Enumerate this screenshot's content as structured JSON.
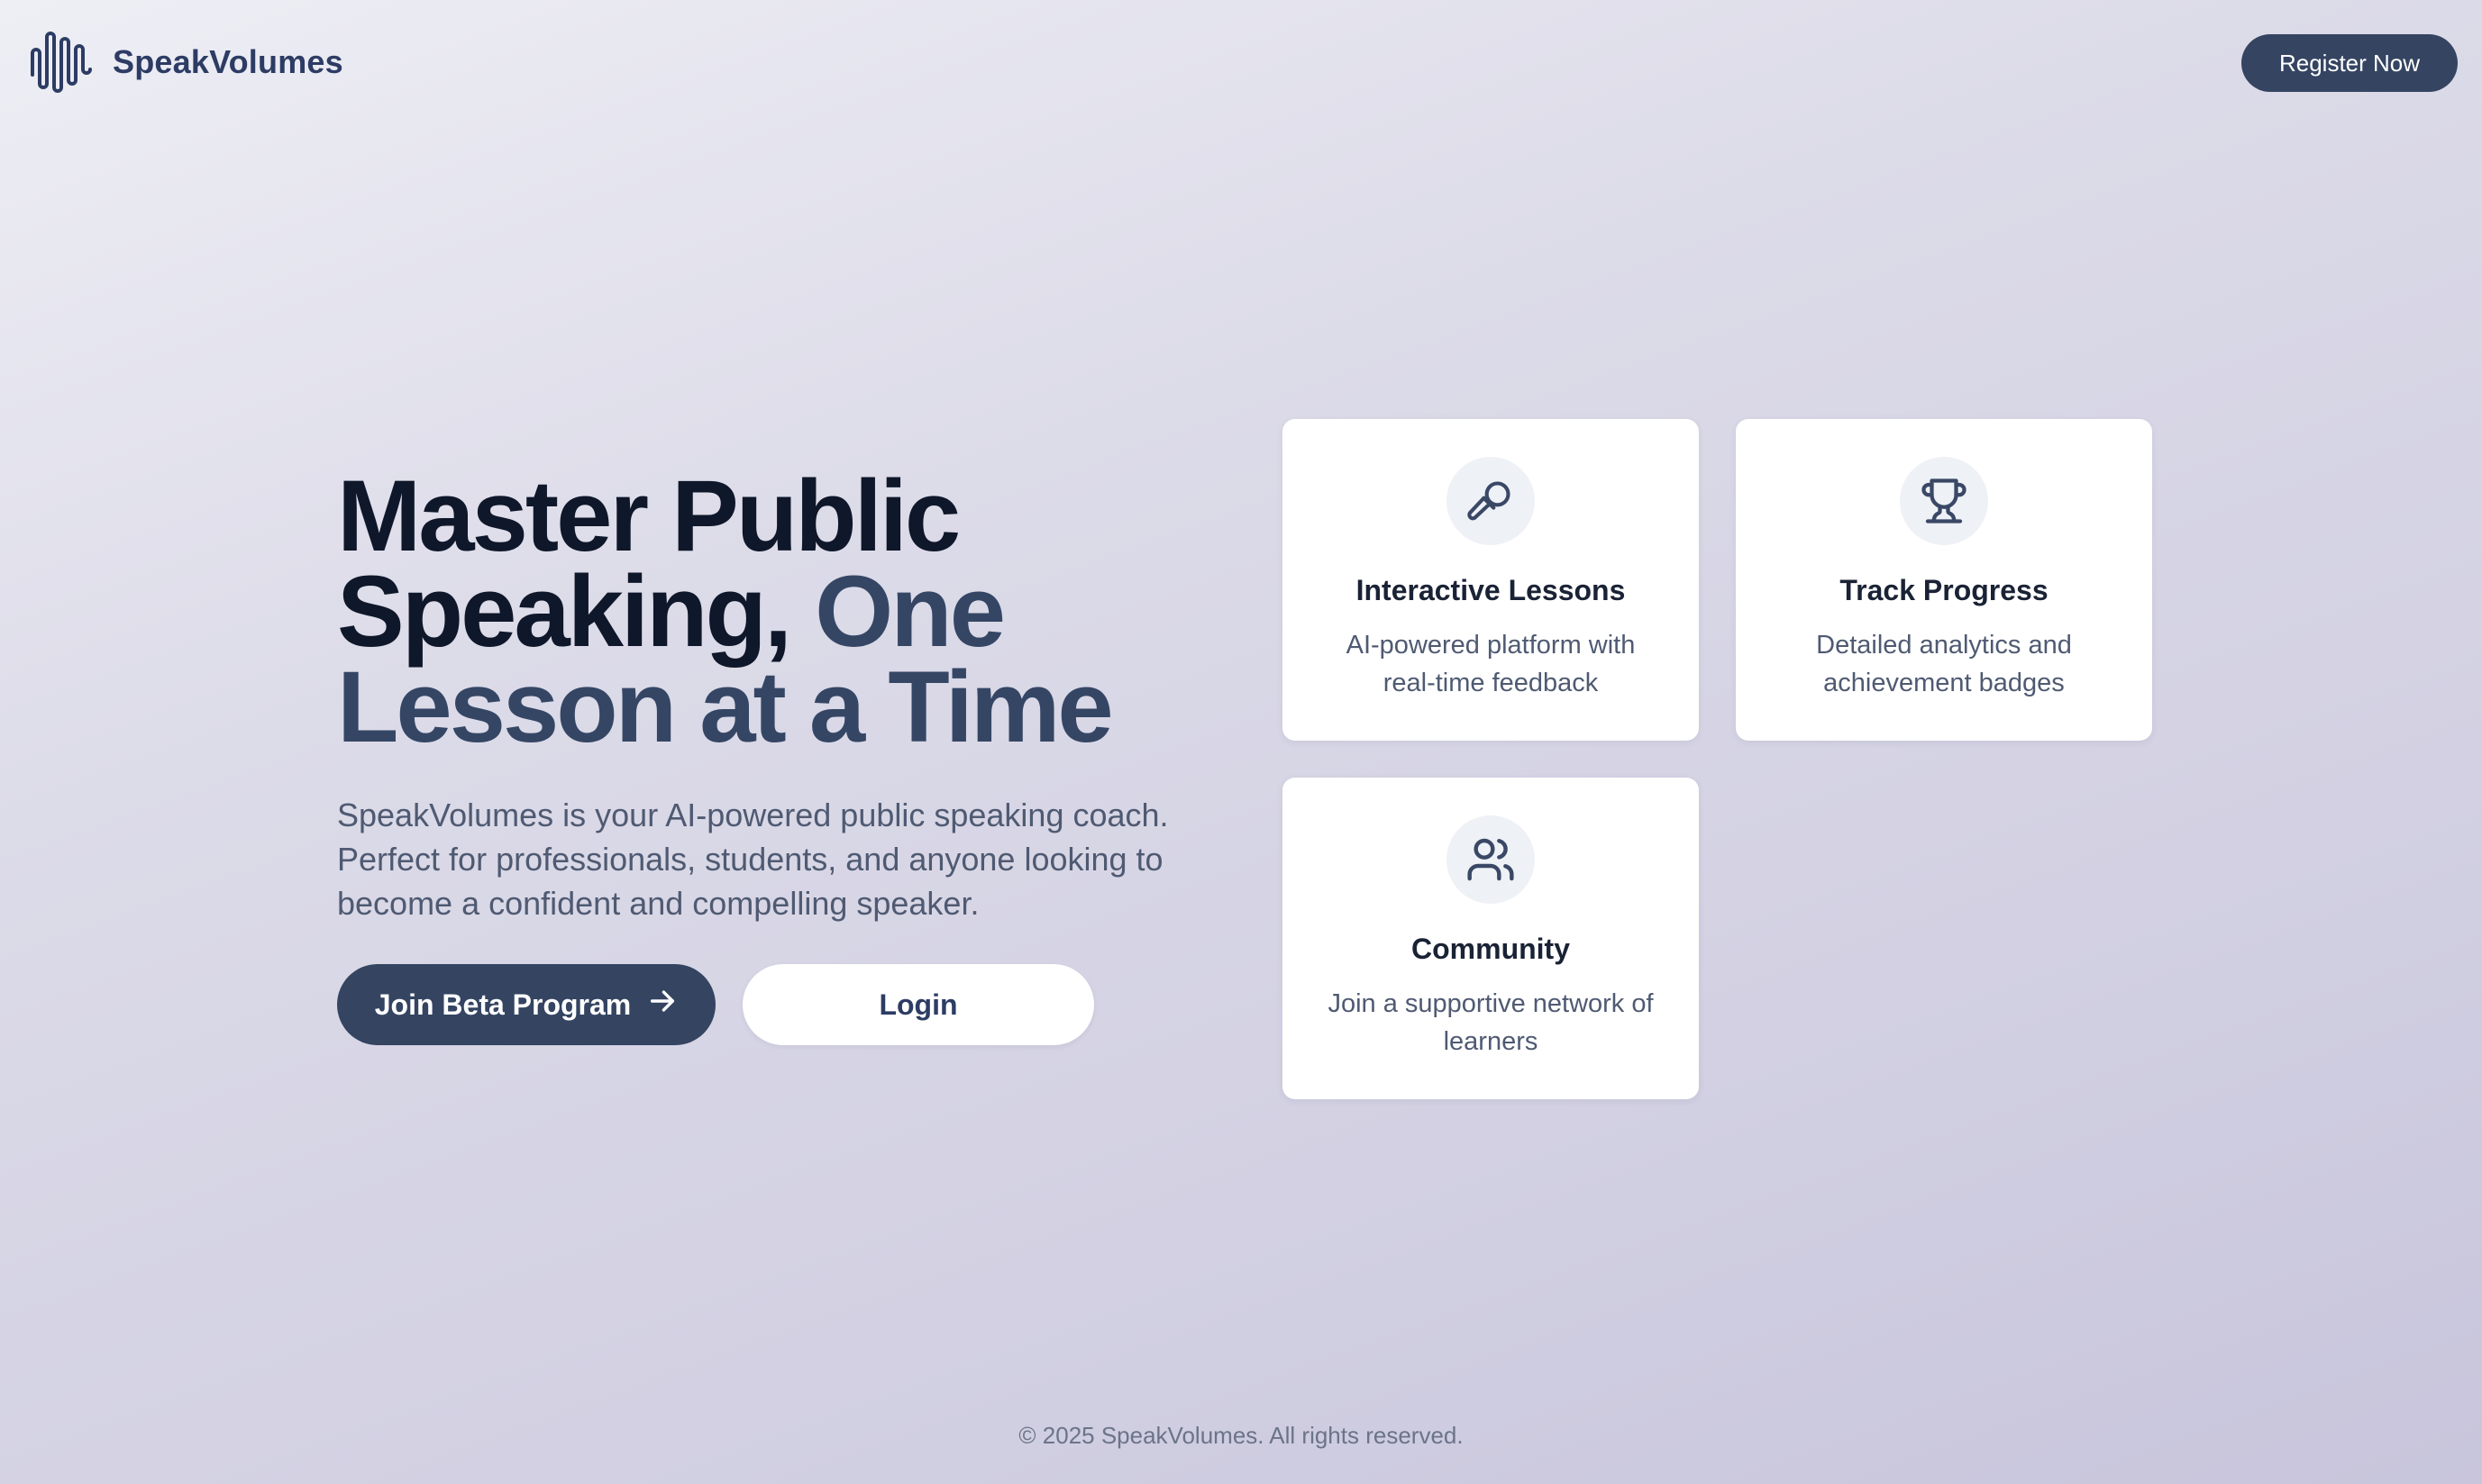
{
  "header": {
    "logo_text": "SpeakVolumes",
    "logo_icon": "sound-wave-icon",
    "register_label": "Register Now"
  },
  "hero": {
    "title_line1": "Master Public",
    "title_line2_dark": "Speaking,",
    "title_line2_accent": "One",
    "title_line3_accent": "Lesson at a Time",
    "description": "SpeakVolumes is your AI-powered public speaking coach. Perfect for professionals, students, and anyone looking to become a confident and compelling speaker.",
    "primary_button": "Join Beta Program",
    "primary_button_icon": "arrow-right-icon",
    "secondary_button": "Login"
  },
  "features": [
    {
      "icon": "microphone-icon",
      "title": "Interactive Lessons",
      "description": "AI-powered platform with real-time feedback"
    },
    {
      "icon": "trophy-icon",
      "title": "Track Progress",
      "description": "Detailed analytics and achievement badges"
    },
    {
      "icon": "users-icon",
      "title": "Community",
      "description": "Join a supportive network of learners"
    }
  ],
  "footer": {
    "copyright": "© 2025 SpeakVolumes. All rights reserved."
  },
  "colors": {
    "primary": "#344461",
    "heading": "#0f172a",
    "accent_heading": "#354665",
    "body_text": "#4f5a72",
    "card_bg": "#ffffff",
    "icon_bg": "#eef1f6"
  }
}
